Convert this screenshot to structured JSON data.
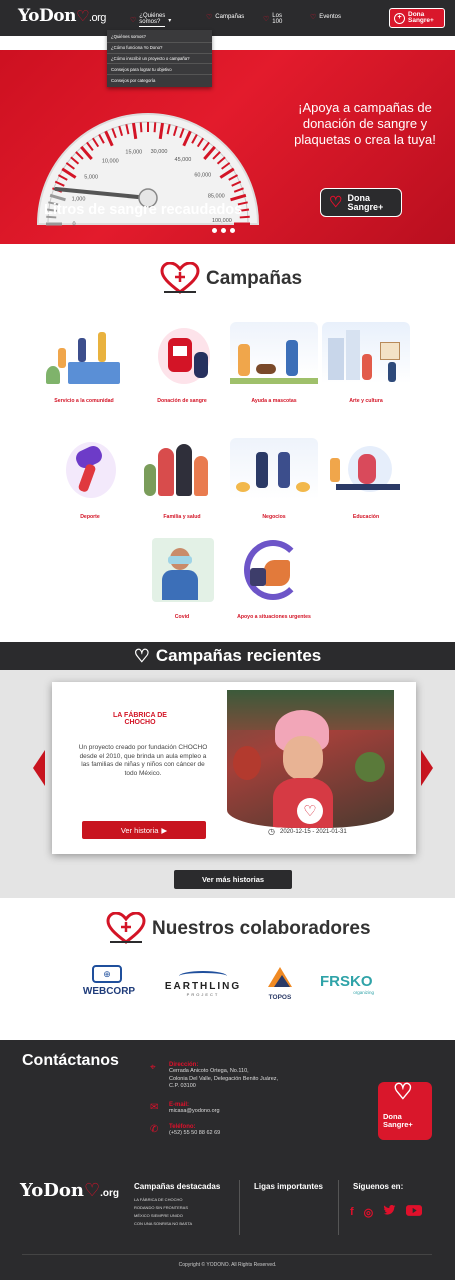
{
  "brand": {
    "name_yo": "YoDon",
    "org": ".org"
  },
  "nav": {
    "items": [
      {
        "label": "¿Quiénes somos?"
      },
      {
        "label": "Campañas"
      },
      {
        "label": "Los 100"
      },
      {
        "label": "Eventos"
      }
    ],
    "cta_line1": "Dona",
    "cta_line2": "Sangre+"
  },
  "dropdown": {
    "items": [
      "¿Quiénes somos?",
      "¿Cómo funciona Yo Dono?",
      "¿Cómo inscribir un proyecto o campaña?",
      "Consejos para lograr tu objetivo",
      "Consejos por categoría"
    ]
  },
  "hero": {
    "gauge_ticks": [
      "0",
      "1,000",
      "5,000",
      "10,000",
      "15,000",
      "30,000",
      "45,000",
      "60,000",
      "85,000",
      "100,000"
    ],
    "title": "Litros de sangre recaudados",
    "tagline": "¡Apoya a campañas de donación de sangre y plaquetas o crea la tuya!",
    "cta_line1": "Dona",
    "cta_line2": "Sangre+",
    "slides": 3
  },
  "campaigns": {
    "title": "Campañas",
    "categories": [
      {
        "label": "Servicio a la comunidad"
      },
      {
        "label": "Donación de sangre"
      },
      {
        "label": "Ayuda a mascotas"
      },
      {
        "label": "Arte y cultura"
      },
      {
        "label": "Deporte"
      },
      {
        "label": "Familia y salud"
      },
      {
        "label": "Negocios"
      },
      {
        "label": "Educación"
      },
      {
        "label": "Covid"
      },
      {
        "label": "Apoyo a situaciones urgentes"
      }
    ]
  },
  "recent": {
    "title": "Campañas recientes",
    "story": {
      "title": "LA FÁBRICA DE CHOCHO",
      "description": "Un proyecto creado por fundación CHOCHO desde el 2010, que brinda un aula empleo a las familias de niñas y niños con cáncer de todo México.",
      "button": "Ver historia",
      "dates": "2020-12-15 - 2021-01-31"
    },
    "more_button": "Ver más historias"
  },
  "collaborators": {
    "title": "Nuestros colaboradores",
    "logos": [
      "WEBCORP",
      "EARTHLING",
      "PROJECT",
      "TOPOS",
      "FRSKO",
      "organizing"
    ]
  },
  "footer": {
    "contact_title": "Contáctanos",
    "address_label": "Dirección:",
    "address_lines": [
      "Cerrada Anicoto Ortega, No.110,",
      "Colonia Del Valle, Delegación Benito Juárez,",
      "C.P. 03100"
    ],
    "email_label": "E-mail:",
    "email": "micasa@yodono.org",
    "phone_label": "Teléfono:",
    "phone": "(+52) 55 50 88 62 69",
    "cta_line1": "Dona",
    "cta_line2": "Sangre+",
    "featured_title": "Campañas destacadas",
    "featured_links": [
      "LA FÁBRICA DE CHOCHO",
      "RODANDO SIN FRONTERAS",
      "MÉXICO SIEMPRE UNIDO",
      "CON UNA SONRISA NO BASTA"
    ],
    "links_title": "Ligas importantes",
    "follow_title": "Síguenos en:",
    "social": [
      "f",
      "◎",
      "🐦",
      "▶"
    ],
    "copyright": "Copyright © YODONO. All Rights Reserved."
  }
}
